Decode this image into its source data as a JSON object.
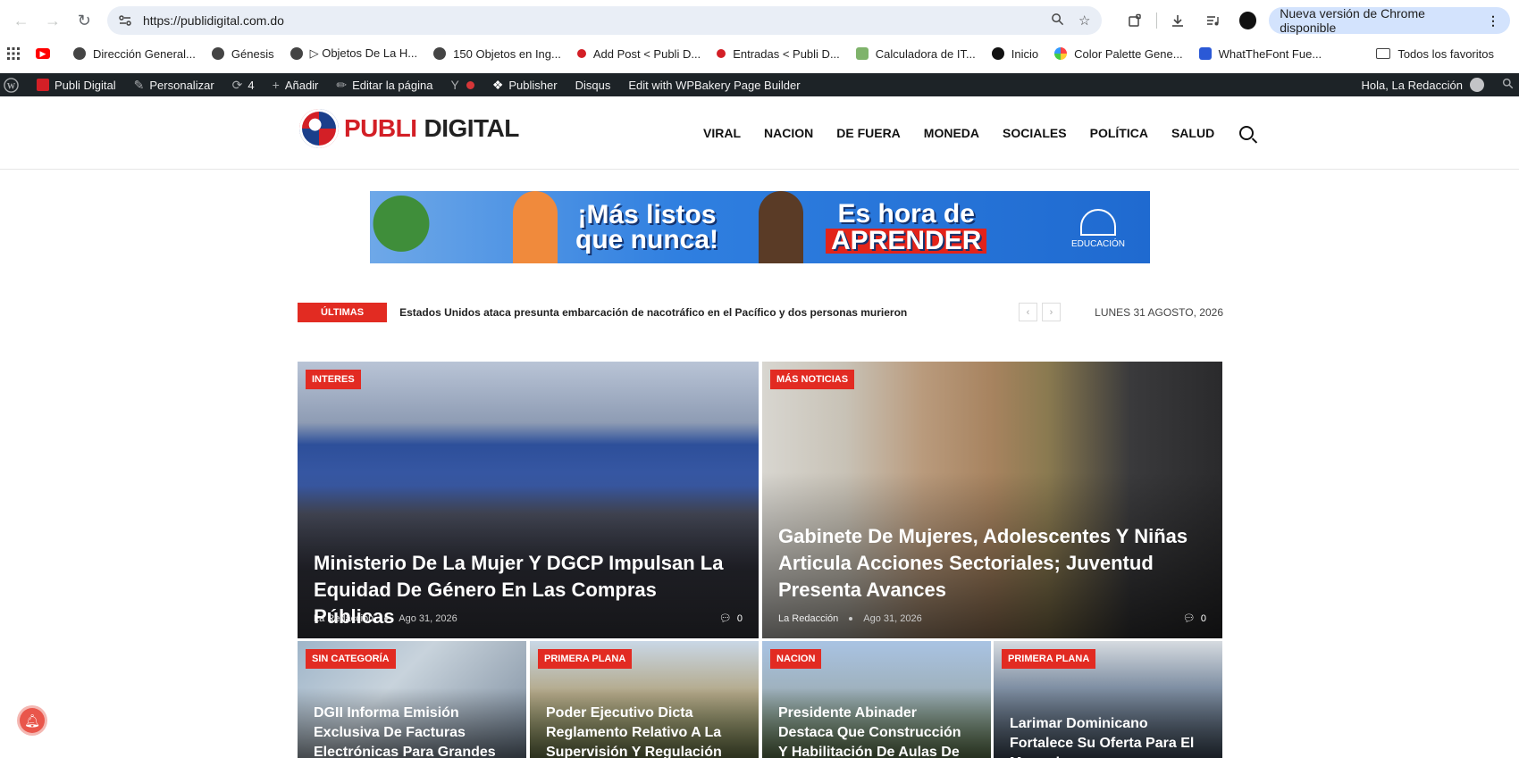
{
  "browser": {
    "url": "https://publidigital.com.do",
    "update_label": "Nueva versión de Chrome disponible"
  },
  "bookmarks": [
    {
      "label": "Dirección General...",
      "icon": "globe-icon"
    },
    {
      "label": "Génesis",
      "icon": "globe-icon"
    },
    {
      "label": "▷ Objetos De La H...",
      "icon": "globe-icon"
    },
    {
      "label": "150 Objetos en Ing...",
      "icon": "globe-icon"
    },
    {
      "label": "Add Post < Publi D...",
      "icon": "publi-icon"
    },
    {
      "label": "Entradas < Publi D...",
      "icon": "publi-icon"
    },
    {
      "label": "Calculadora de IT...",
      "icon": "calc-icon"
    },
    {
      "label": "Inicio",
      "icon": "inicio-icon"
    },
    {
      "label": "Color Palette Gene...",
      "icon": "palette-icon"
    },
    {
      "label": "WhatTheFont Fue...",
      "icon": "font-icon"
    }
  ],
  "bookmarks_all": "Todos los favoritos",
  "wp_admin": {
    "site": "Publi Digital",
    "customize": "Personalizar",
    "updates": "4",
    "add": "Añadir",
    "edit": "Editar la página",
    "publisher": "Publisher",
    "disqus": "Disqus",
    "wpbakery": "Edit with WPBakery Page Builder",
    "greeting": "Hola, La Redacción"
  },
  "site": {
    "logo_part1": "PUBLI",
    "logo_part2": "DIGITAL",
    "nav": [
      "VIRAL",
      "NACION",
      "DE FUERA",
      "MONEDA",
      "SOCIALES",
      "POLÍTICA",
      "SALUD"
    ]
  },
  "banner": {
    "line1a": "¡Más listos",
    "line1b": "que nunca!",
    "line2a": "Es hora de",
    "line2b": "APRENDER",
    "brand": "EDUCACIÓN"
  },
  "ticker": {
    "label": "ÚLTIMAS",
    "headline": "Estados Unidos ataca presunta embarcación de nacotráfico en el Pacífico y dos personas murieron",
    "date": "LUNES 31 AGOSTO, 2026"
  },
  "articles": {
    "big": [
      {
        "category": "INTERES",
        "title": "Ministerio De La Mujer Y DGCP Impulsan La Equidad De Género En Las Compras Públicas",
        "author": "La Redacción",
        "date": "Ago 31, 2026",
        "comments": "0"
      },
      {
        "category": "MÁS NOTICIAS",
        "title": "Gabinete De Mujeres, Adolescentes Y Niñas Articula Acciones Sectoriales; Juventud Presenta Avances",
        "author": "La Redacción",
        "date": "Ago 31, 2026",
        "comments": "0"
      }
    ],
    "small": [
      {
        "category": "SIN CATEGORÍA",
        "title": "DGII Informa Emisión Exclusiva De Facturas Electrónicas Para Grandes"
      },
      {
        "category": "PRIMERA PLANA",
        "title": "Poder Ejecutivo Dicta Reglamento Relativo A La Supervisión Y Regulación Del"
      },
      {
        "category": "NACION",
        "title": "Presidente Abinader Destaca Que Construcción Y Habilitación De Aulas De Nivel"
      },
      {
        "category": "PRIMERA PLANA",
        "title": "Larimar Dominicano Fortalece Su Oferta Para El Mercado"
      }
    ]
  },
  "colors": {
    "accent": "#e22b22",
    "wp_bar": "#1d2327",
    "chrome_pill": "#d3e3fd"
  }
}
